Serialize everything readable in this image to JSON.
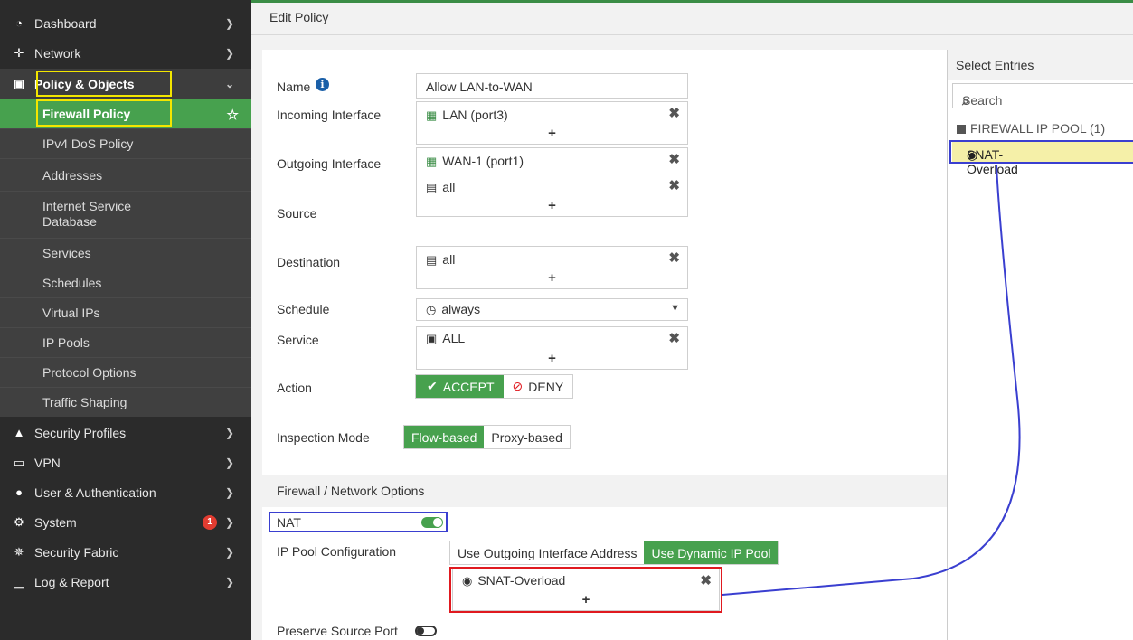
{
  "sidebar": {
    "items": [
      {
        "label": "Dashboard",
        "icon": "dashboard-icon",
        "glyph": "◔"
      },
      {
        "label": "Network",
        "icon": "network-icon",
        "glyph": "✛"
      },
      {
        "label": "Policy & Objects",
        "icon": "policy-icon",
        "glyph": "▣"
      },
      {
        "label": "Security Profiles",
        "icon": "lock-icon",
        "glyph": "▲"
      },
      {
        "label": "VPN",
        "icon": "vpn-icon",
        "glyph": "▭"
      },
      {
        "label": "User & Authentication",
        "icon": "user-icon",
        "glyph": "●"
      },
      {
        "label": "System",
        "icon": "gear-icon",
        "glyph": "⚙",
        "badge": "1"
      },
      {
        "label": "Security Fabric",
        "icon": "fabric-icon",
        "glyph": "✵"
      },
      {
        "label": "Log & Report",
        "icon": "chart-icon",
        "glyph": "▁"
      }
    ],
    "policy_sub": [
      "Firewall Policy",
      "IPv4 DoS Policy",
      "Addresses",
      "Internet Service Database",
      "Services",
      "Schedules",
      "Virtual IPs",
      "IP Pools",
      "Protocol Options",
      "Traffic Shaping"
    ]
  },
  "page": {
    "title": "Edit Policy"
  },
  "form": {
    "name_label": "Name",
    "name_value": "Allow LAN-to-WAN",
    "incoming_label": "Incoming Interface",
    "incoming_value": "LAN (port3)",
    "outgoing_label": "Outgoing Interface",
    "outgoing_value": "WAN-1 (port1)",
    "source_label": "Source",
    "source_value": "all",
    "destination_label": "Destination",
    "destination_value": "all",
    "schedule_label": "Schedule",
    "schedule_value": "always",
    "service_label": "Service",
    "service_value": "ALL",
    "action_label": "Action",
    "action_accept": "ACCEPT",
    "action_deny": "DENY",
    "inspection_label": "Inspection Mode",
    "inspection_flow": "Flow-based",
    "inspection_proxy": "Proxy-based",
    "plus": "+",
    "remove": "✖"
  },
  "firewall_options": {
    "section_title": "Firewall / Network Options",
    "nat_label": "NAT",
    "nat_enabled": true,
    "ippool_label": "IP Pool Configuration",
    "ippool_outgoing": "Use Outgoing Interface Address",
    "ippool_dynamic": "Use Dynamic IP Pool",
    "ippool_value": "SNAT-Overload",
    "preserve_label": "Preserve Source Port",
    "preserve_enabled": false
  },
  "select_entries": {
    "title": "Select Entries",
    "search_placeholder": "Search",
    "group_label": "FIREWALL IP POOL (1)",
    "entry": "SNAT-Overload"
  },
  "colors": {
    "accent_green": "#47a14e",
    "highlight_yellow": "#f3e600",
    "annotation_blue": "#3a3fd0",
    "annotation_red": "#e0191f"
  }
}
